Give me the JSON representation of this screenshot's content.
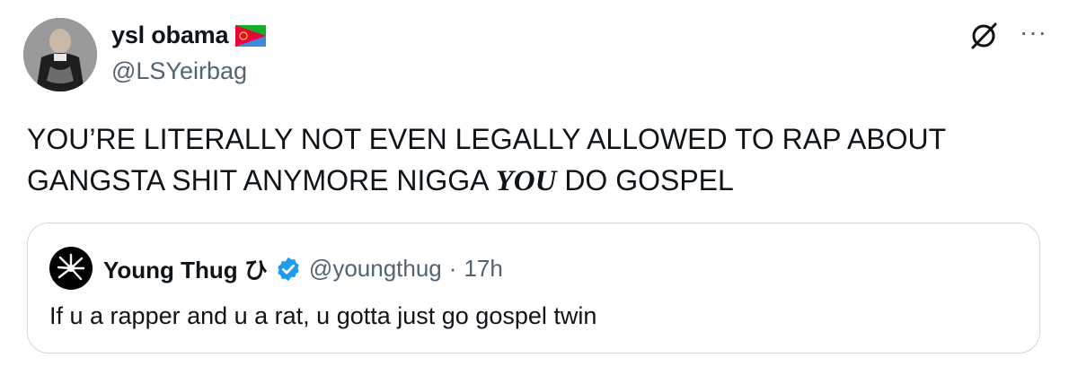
{
  "author": {
    "display_name": "ysl obama",
    "flag_icon": "eritrea-flag-icon",
    "handle": "@LSYeirbag"
  },
  "tweet": {
    "text_part1": "YOU’RE LITERALLY NOT EVEN LEGALLY ALLOWED TO RAP ABOUT GANGSTA SHIT ANYMORE NIGGA ",
    "text_emphasis": "YOU",
    "text_part2": " DO GOSPEL"
  },
  "quoted_tweet": {
    "display_name": "Young Thug ひ",
    "handle": "@youngthug",
    "separator": "·",
    "time": "17h",
    "text": "If u a rapper and u a rat, u gotta just go gospel twin",
    "verified": true
  },
  "actions": {
    "grok_icon": "grok-icon",
    "more_label": "···"
  },
  "colors": {
    "text": "#0f1419",
    "secondary": "#536471",
    "border": "#cfd9de",
    "verified_blue": "#1d9bf0"
  }
}
